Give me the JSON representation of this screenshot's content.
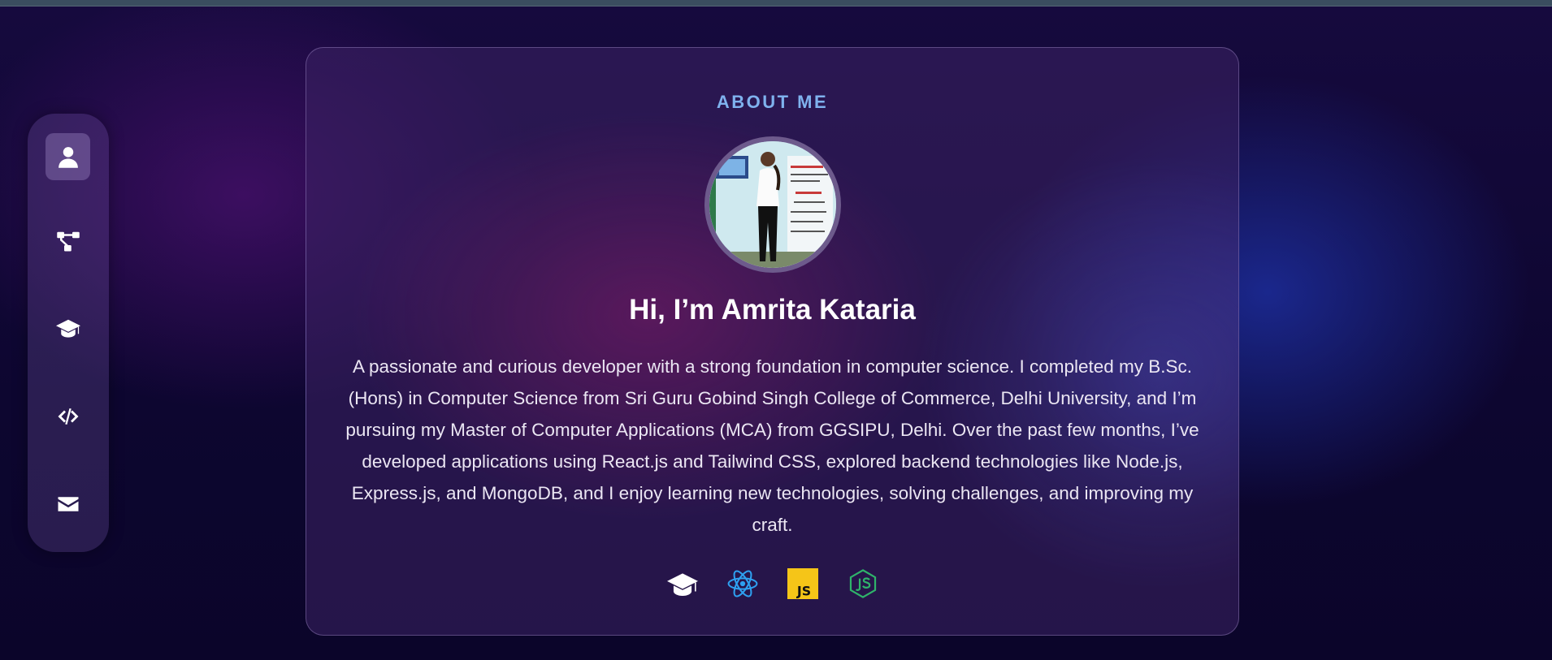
{
  "sidebar": {
    "items": [
      {
        "icon": "user-icon",
        "active": true
      },
      {
        "icon": "sitemap-icon",
        "active": false
      },
      {
        "icon": "graduation-cap-icon",
        "active": false
      },
      {
        "icon": "code-icon",
        "active": false
      },
      {
        "icon": "envelope-icon",
        "active": false
      }
    ]
  },
  "about": {
    "title": "ABOUT ME",
    "heading": "Hi, I’m Amrita Kataria",
    "bio": "A passionate and curious developer with a strong foundation in computer science. I completed my B.Sc. (Hons) in Computer Science from Sri Guru Gobind Singh College of Commerce, Delhi University, and I’m pursuing my Master of Computer Applications (MCA) from GGSIPU, Delhi. Over the past few months, I’ve developed applications using React.js and Tailwind CSS, explored backend technologies like Node.js, Express.js, and MongoDB, and I enjoy learning new technologies, solving challenges, and improving my craft.",
    "tech_icons": [
      "graduation-cap-icon",
      "react-icon",
      "javascript-icon",
      "nodejs-icon"
    ],
    "js_badge": "JS"
  },
  "colors": {
    "accent": "#7fb2ee",
    "react": "#2ea0f0",
    "javascript": "#f5c518",
    "node": "#2fb36a"
  }
}
